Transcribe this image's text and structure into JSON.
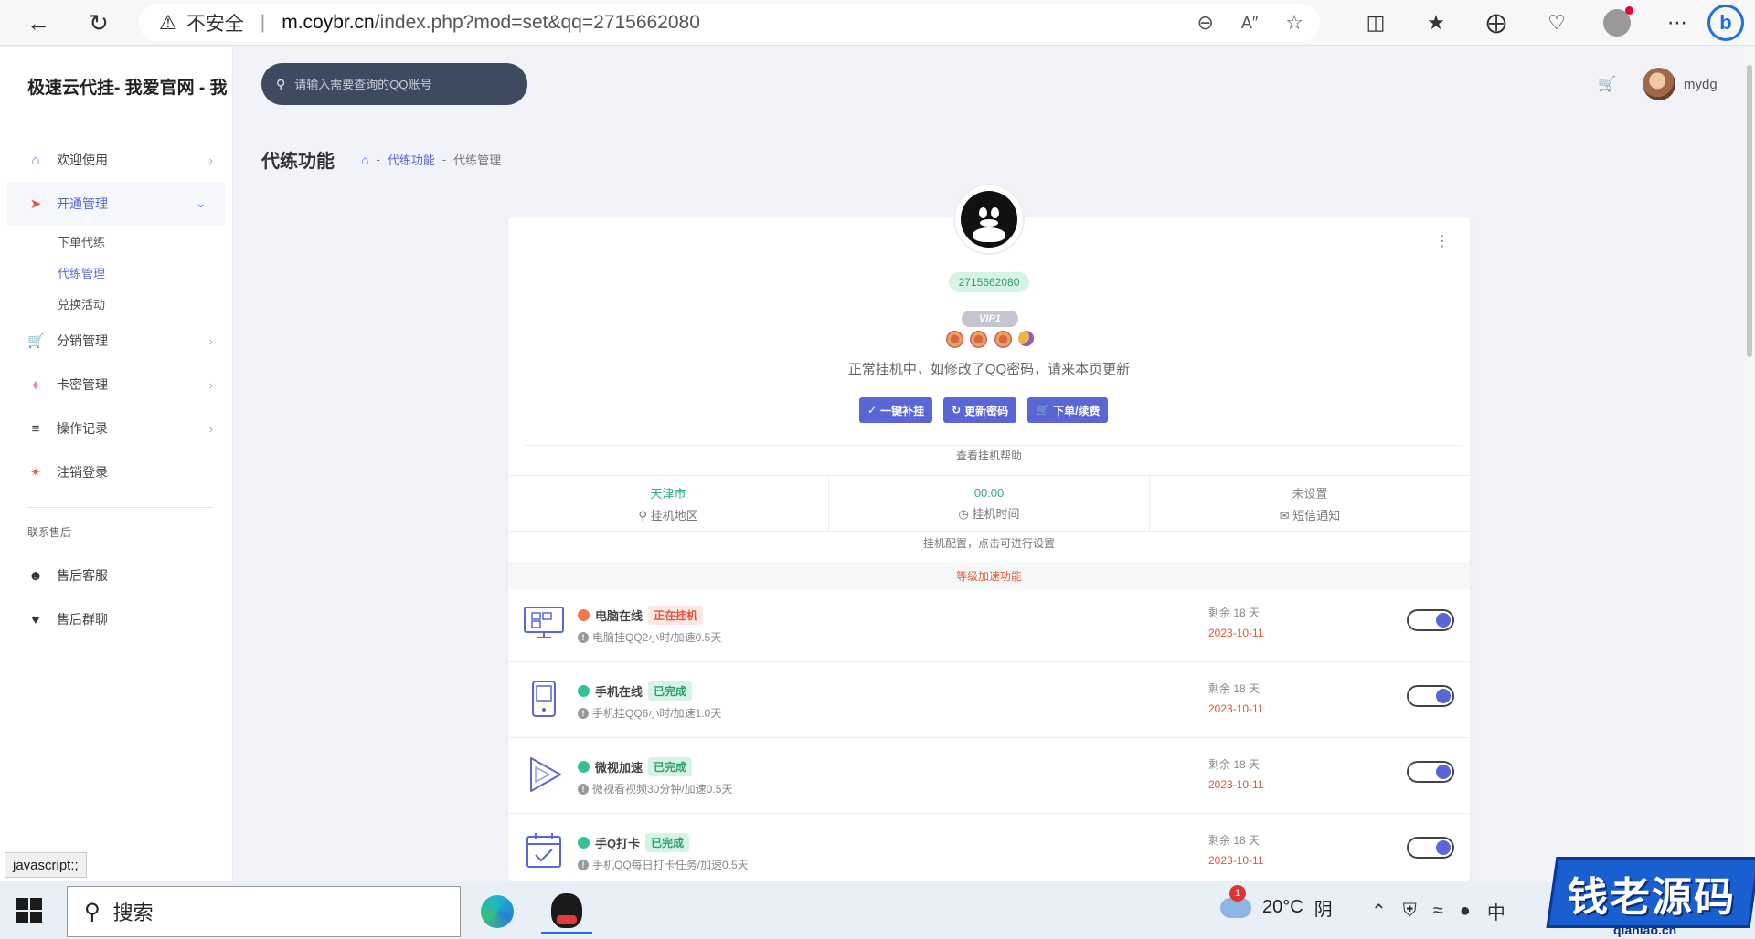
{
  "browser": {
    "insecure_label": "不安全",
    "url_host": "m.coybr.cn",
    "url_path": "/index.php?mod=set&qq=2715662080"
  },
  "sidebar": {
    "brand": "极速云代挂- 我爱官网 - 我",
    "items": [
      {
        "label": "欢迎使用",
        "icon": "store-icon"
      },
      {
        "label": "开通管理",
        "icon": "rocket-icon"
      },
      {
        "label": "分销管理",
        "icon": "cart-icon"
      },
      {
        "label": "卡密管理",
        "icon": "diamond-icon"
      },
      {
        "label": "操作记录",
        "icon": "list-icon"
      },
      {
        "label": "注销登录",
        "icon": "run-icon"
      }
    ],
    "submenu": [
      "下单代练",
      "代练管理",
      "兑换活动"
    ],
    "section_title": "联系售后",
    "support": [
      {
        "label": "售后客服",
        "icon": "smile-icon"
      },
      {
        "label": "售后群聊",
        "icon": "heart-icon"
      }
    ]
  },
  "header": {
    "search_placeholder": "请输入需要查询的QQ账号",
    "username": "mydg"
  },
  "page": {
    "title": "代练功能",
    "breadcrumb": [
      "代练功能",
      "代练管理"
    ]
  },
  "profile": {
    "qq": "2715662080",
    "vip": "VIP1",
    "status_text": "正常挂机中，如修改了QQ密码，请来本页更新",
    "buttons": [
      "一键补挂",
      "更新密码",
      "下单/续费"
    ],
    "help_text": "查看挂机帮助"
  },
  "stats": [
    {
      "value": "天津市",
      "label": "挂机地区",
      "icon": "pin-icon"
    },
    {
      "value": "00:00",
      "label": "挂机时间",
      "icon": "clock-icon"
    },
    {
      "value": "未设置",
      "label": "短信通知",
      "icon": "mail-icon"
    }
  ],
  "config_text": "挂机配置，点击可进行设置",
  "speed_header": "等级加速功能",
  "features": [
    {
      "name": "电脑在线",
      "status": "正在挂机",
      "status_type": "running",
      "dot": "#f07a4a",
      "desc": "电脑挂QQ2小时/加速0.5天",
      "remain": "剩余 18 天",
      "date": "2023-10-11",
      "icon": "desktop-icon"
    },
    {
      "name": "手机在线",
      "status": "已完成",
      "status_type": "done",
      "dot": "#34c38f",
      "desc": "手机挂QQ6小时/加速1.0天",
      "remain": "剩余 18 天",
      "date": "2023-10-11",
      "icon": "phone-icon"
    },
    {
      "name": "微视加速",
      "status": "已完成",
      "status_type": "done",
      "dot": "#34c38f",
      "desc": "微视看视频30分钟/加速0.5天",
      "remain": "剩余 18 天",
      "date": "2023-10-11",
      "icon": "play-icon"
    },
    {
      "name": "手Q打卡",
      "status": "已完成",
      "status_type": "done",
      "dot": "#34c38f",
      "desc": "手机QQ每日打卡任务/加速0.5天",
      "remain": "剩余 18 天",
      "date": "2023-10-11",
      "icon": "calendar-icon"
    }
  ],
  "status_bar": "javascript:;",
  "taskbar": {
    "search": "搜索",
    "weather_temp": "20°C",
    "weather_cond": "阴",
    "notif_count": "1",
    "ime": "中"
  },
  "watermark": {
    "text": "钱老源码",
    "sub": "qianlao.cn"
  },
  "colors": {
    "accent": "#5b66d6",
    "success": "#34c38f",
    "danger": "#e3563a",
    "search_bg": "#3e4a60"
  }
}
